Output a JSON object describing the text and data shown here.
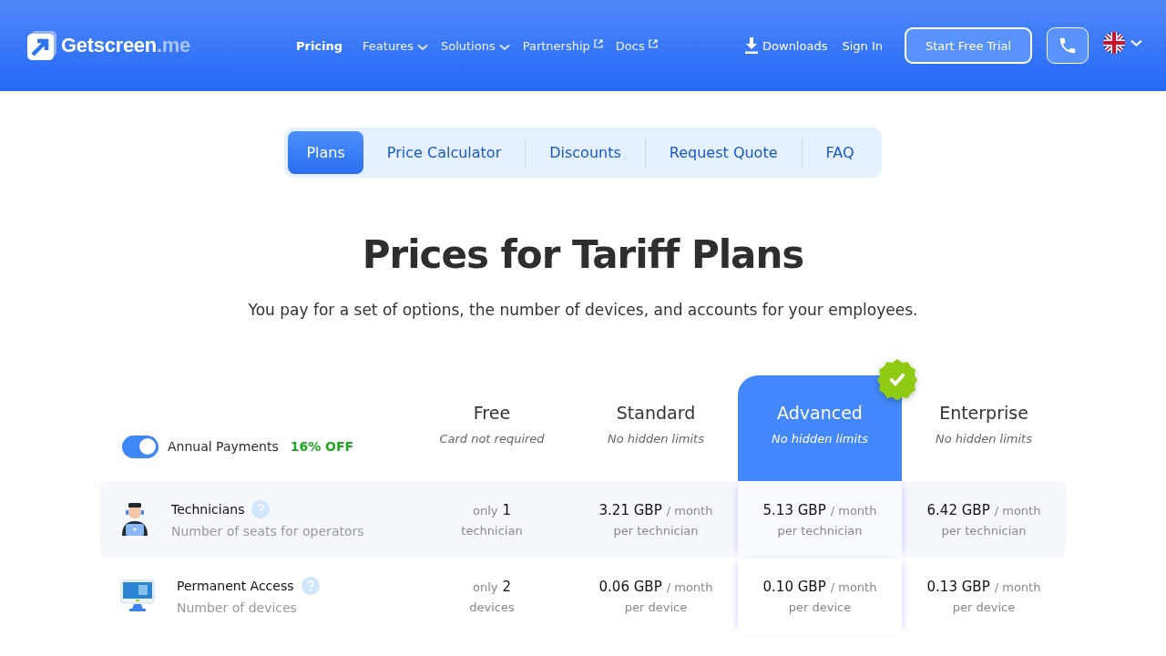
{
  "header": {
    "logo": {
      "name": "Getscreen",
      "suffix": ".me"
    },
    "nav": [
      {
        "label": "Pricing",
        "selected": true,
        "kind": "plain"
      },
      {
        "label": "Features",
        "selected": false,
        "kind": "dropdown"
      },
      {
        "label": "Solutions",
        "selected": false,
        "kind": "dropdown"
      },
      {
        "label": "Partnership",
        "selected": false,
        "kind": "external"
      },
      {
        "label": "Docs",
        "selected": false,
        "kind": "external"
      }
    ],
    "downloads": "Downloads",
    "sign_in": "Sign In",
    "trial_button": "Start Free Trial"
  },
  "tabs": [
    {
      "label": "Plans",
      "selected": true
    },
    {
      "label": "Price Calculator",
      "selected": false
    },
    {
      "label": "Discounts",
      "selected": false
    },
    {
      "label": "Request Quote",
      "selected": false
    },
    {
      "label": "FAQ",
      "selected": false
    }
  ],
  "title": "Prices for Tariff Plans",
  "subtitle": "You pay for a set of options, the number of devices, and accounts for your employees.",
  "billing": {
    "label": "Annual Payments",
    "on": true,
    "discount": "16% OFF"
  },
  "plans": [
    {
      "name": "Free",
      "note": "Card not required",
      "selected": false
    },
    {
      "name": "Standard",
      "note": "No hidden limits",
      "selected": false
    },
    {
      "name": "Advanced",
      "note": "No hidden limits",
      "selected": true
    },
    {
      "name": "Enterprise",
      "note": "No hidden limits",
      "selected": false
    }
  ],
  "rows": [
    {
      "kind": "technician",
      "title": "Technicians",
      "subtitle": "Number of seats for operators",
      "cells": [
        {
          "kind": "free",
          "prefix": "only",
          "amount": "1",
          "per": "technician"
        },
        {
          "kind": "price",
          "amount": "3.21 GBP",
          "unit": "/ month",
          "per": "per technician"
        },
        {
          "kind": "price",
          "amount": "5.13 GBP",
          "unit": "/ month",
          "per": "per technician"
        },
        {
          "kind": "price",
          "amount": "6.42 GBP",
          "unit": "/ month",
          "per": "per technician"
        }
      ]
    },
    {
      "kind": "monitor",
      "title": "Permanent Access",
      "subtitle": "Number of devices",
      "cells": [
        {
          "kind": "free",
          "prefix": "only",
          "amount": "2",
          "per": "devices"
        },
        {
          "kind": "price",
          "amount": "0.06 GBP",
          "unit": "/ month",
          "per": "per device"
        },
        {
          "kind": "price",
          "amount": "0.10 GBP",
          "unit": "/ month",
          "per": "per device"
        },
        {
          "kind": "price",
          "amount": "0.13 GBP",
          "unit": "/ month",
          "per": "per device"
        }
      ]
    }
  ]
}
